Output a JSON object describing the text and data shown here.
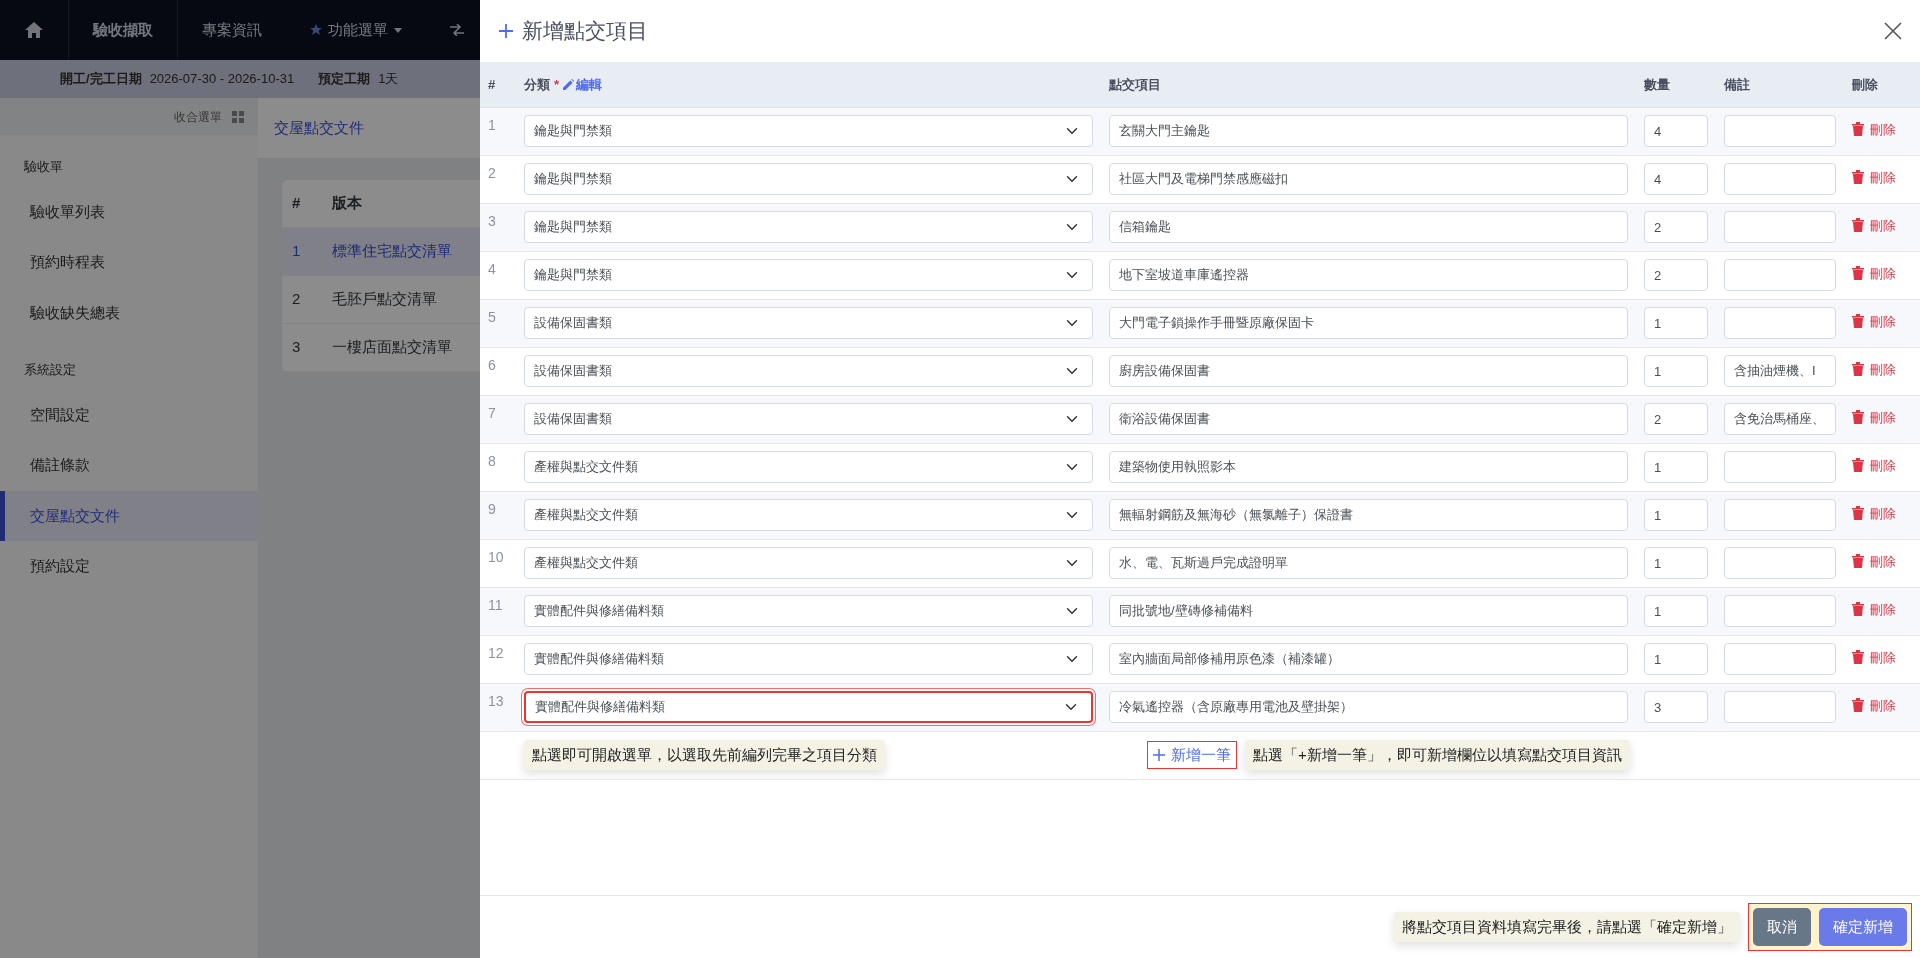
{
  "background": {
    "nav": [
      {
        "kind": "home"
      },
      {
        "kind": "brand",
        "label": "驗收擷取"
      },
      {
        "kind": "link",
        "label": "專案資訊"
      },
      {
        "kind": "menu",
        "label": "功能選單"
      },
      {
        "kind": "switch"
      }
    ],
    "info": [
      {
        "label": "開工/完工日期",
        "value": "2026-07-30 - 2026-10-31"
      },
      {
        "label": "預定工期",
        "value": "1天"
      }
    ],
    "sidebar": {
      "collapse_label": "收合選單",
      "sections": [
        {
          "title": "驗收單",
          "items": [
            {
              "label": "驗收單列表",
              "selected": false
            },
            {
              "label": "預約時程表",
              "selected": false
            },
            {
              "label": "驗收缺失總表",
              "selected": false
            }
          ]
        },
        {
          "title": "系統設定",
          "items": [
            {
              "label": "空間設定",
              "selected": false
            },
            {
              "label": "備註條款",
              "selected": false
            },
            {
              "label": "交屋點交文件",
              "selected": true
            },
            {
              "label": "預約設定",
              "selected": false
            }
          ]
        }
      ]
    },
    "content": {
      "title": "交屋點交文件",
      "columns": [
        "#",
        "版本"
      ],
      "rows": [
        {
          "num": "1",
          "name": "標準住宅點交清單",
          "selected": true
        },
        {
          "num": "2",
          "name": "毛胚戶點交清單",
          "selected": false
        },
        {
          "num": "3",
          "name": "一樓店面點交清單",
          "selected": false
        }
      ]
    }
  },
  "modal": {
    "title": "新增點交項目",
    "columns": {
      "num": "#",
      "category": "分類",
      "required_mark": "*",
      "edit_link": "編輯",
      "item": "點交項目",
      "qty": "數量",
      "note": "備註",
      "delete": "刪除"
    },
    "rows": [
      {
        "num": "1",
        "category": "鑰匙與門禁類",
        "item": "玄關大門主鑰匙",
        "qty": "4",
        "note": "",
        "delete": "刪除",
        "highlighted": false
      },
      {
        "num": "2",
        "category": "鑰匙與門禁類",
        "item": "社區大門及電梯門禁感應磁扣",
        "qty": "4",
        "note": "",
        "delete": "刪除",
        "highlighted": false
      },
      {
        "num": "3",
        "category": "鑰匙與門禁類",
        "item": "信箱鑰匙",
        "qty": "2",
        "note": "",
        "delete": "刪除",
        "highlighted": false
      },
      {
        "num": "4",
        "category": "鑰匙與門禁類",
        "item": "地下室坡道車庫遙控器",
        "qty": "2",
        "note": "",
        "delete": "刪除",
        "highlighted": false
      },
      {
        "num": "5",
        "category": "設備保固書類",
        "item": "大門電子鎖操作手冊暨原廠保固卡",
        "qty": "1",
        "note": "",
        "delete": "刪除",
        "highlighted": false
      },
      {
        "num": "6",
        "category": "設備保固書類",
        "item": "廚房設備保固書",
        "qty": "1",
        "note": "含抽油煙機、I",
        "delete": "刪除",
        "highlighted": false
      },
      {
        "num": "7",
        "category": "設備保固書類",
        "item": "衛浴設備保固書",
        "qty": "2",
        "note": "含免治馬桶座、",
        "delete": "刪除",
        "highlighted": false
      },
      {
        "num": "8",
        "category": "產權與點交文件類",
        "item": "建築物使用執照影本",
        "qty": "1",
        "note": "",
        "delete": "刪除",
        "highlighted": false
      },
      {
        "num": "9",
        "category": "產權與點交文件類",
        "item": "無輻射鋼筋及無海砂（無氯離子）保證書",
        "qty": "1",
        "note": "",
        "delete": "刪除",
        "highlighted": false
      },
      {
        "num": "10",
        "category": "產權與點交文件類",
        "item": "水、電、瓦斯過戶完成證明單",
        "qty": "1",
        "note": "",
        "delete": "刪除",
        "highlighted": false
      },
      {
        "num": "11",
        "category": "實體配件與修繕備料類",
        "item": "同批號地/壁磚修補備料",
        "qty": "1",
        "note": "",
        "delete": "刪除",
        "highlighted": false
      },
      {
        "num": "12",
        "category": "實體配件與修繕備料類",
        "item": "室內牆面局部修補用原色漆（補漆罐）",
        "qty": "1",
        "note": "",
        "delete": "刪除",
        "highlighted": false
      },
      {
        "num": "13",
        "category": "實體配件與修繕備料類",
        "item": "冷氣遙控器（含原廠專用電池及壁掛架）",
        "qty": "3",
        "note": "",
        "delete": "刪除",
        "highlighted": true
      }
    ],
    "category_callout": "點選即可開啟選單，以選取先前編列完畢之項目分類",
    "add_button": {
      "label": "新增一筆",
      "highlighted": true,
      "callout": "點選「+新增一筆」，即可新增欄位以填寫點交項目資訊"
    },
    "footer": {
      "callout": "將點交項目資料填寫完畢後，請點選「確定新增」",
      "highlighted": true,
      "cancel": "取消",
      "confirm": "確定新增"
    }
  }
}
